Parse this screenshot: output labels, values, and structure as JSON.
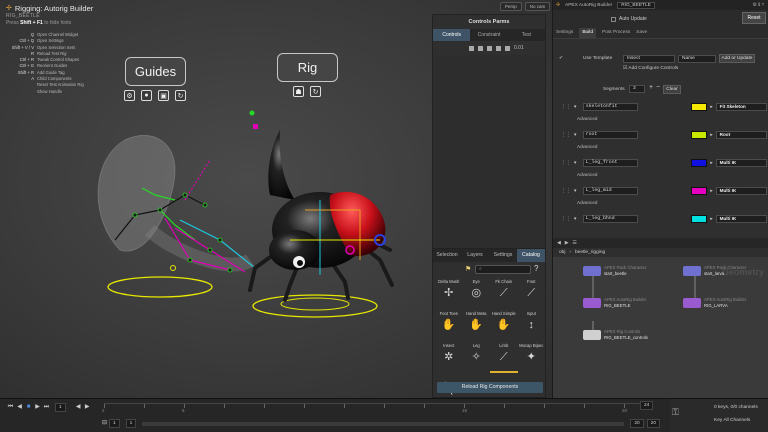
{
  "viewport": {
    "title": "Rigging: Autorig Builder",
    "node": "RIG_BEETLE",
    "hint_prefix": "Press",
    "hint_key": "Shift + F1",
    "hint_suffix": "to hide hints",
    "persp_label": "Persp",
    "cam_label": "No cam",
    "hotkeys": [
      {
        "key": "Q",
        "desc": "Open Channel Widget"
      },
      {
        "key": "Ctrl + Q",
        "desc": "Open Settings"
      },
      {
        "key": "Shift + V / V",
        "desc": "Open Selection Sets"
      },
      {
        "key": "R",
        "desc": "Reload Test Rig"
      },
      {
        "key": "Ctrl + R",
        "desc": "Tweak Control Shapes"
      },
      {
        "key": "Ctrl + G",
        "desc": "Reorient Guides"
      },
      {
        "key": "Shift + R",
        "desc": "Add Guide Tag"
      },
      {
        "key": "A",
        "desc": "Child Components"
      },
      {
        "key": "",
        "desc": "Reset Test Animation Rig"
      },
      {
        "key": "",
        "desc": "Show Handle"
      }
    ],
    "guides_label": "Guides",
    "rig_label": "Rig"
  },
  "controls_panel": {
    "title": "Controls Parms",
    "tabs": [
      "Controls",
      "Constraint",
      "Test"
    ],
    "value": "0.01"
  },
  "catalog": {
    "tabs": [
      "Selection",
      "Layers",
      "Settings",
      "Catalog"
    ],
    "items": [
      {
        "label": "Delta Mush",
        "icon": "✢"
      },
      {
        "label": "Eye",
        "icon": "◎"
      },
      {
        "label": "Fk Chain",
        "icon": "⟋"
      },
      {
        "label": "Foot",
        "icon": "⟋"
      },
      {
        "label": "Foot Toes",
        "icon": "✋"
      },
      {
        "label": "Hand Meta",
        "icon": "✋"
      },
      {
        "label": "Hand Simple",
        "icon": "✋"
      },
      {
        "label": "Input",
        "icon": "↕"
      },
      {
        "label": "Insect",
        "icon": "✲"
      },
      {
        "label": "Leg",
        "icon": "✧"
      },
      {
        "label": "Limb",
        "icon": "⟋"
      },
      {
        "label": "Mocap Bipec",
        "icon": "✦"
      },
      {
        "label": "",
        "icon": "╲"
      },
      {
        "label": "",
        "icon": "⤓"
      },
      {
        "label": "",
        "icon": "☆"
      },
      {
        "label": "",
        "icon": "⟋"
      }
    ],
    "reload_label": "Reload Rig Components"
  },
  "params": {
    "app_label": "APEX AutoRig Builder",
    "node_name": "RIG_BEETLE",
    "auto_update": "Auto Update",
    "reset_label": "Reset",
    "tabs": [
      "Settings",
      "Build",
      "Post Process",
      "Save"
    ],
    "use_template_label": "Use Template",
    "template_value": "Insect",
    "name_value": "Name",
    "add_update_label": "Add or Update",
    "configure_label": "Add Configure Controls",
    "segments_label": "Segments",
    "segments_value": "3",
    "clear_label": "Clear",
    "advanced_label": "Advanced",
    "components": [
      {
        "name": "skeletonfit",
        "color": "#f5e800",
        "type": "Fit Skeleton"
      },
      {
        "name": "root",
        "color": "#c8e800",
        "type": "Root"
      },
      {
        "name": "L_leg_front",
        "color": "#1010e0",
        "type": "Multi IK"
      },
      {
        "name": "L_leg_mid",
        "color": "#e800c0",
        "type": "Multi IK"
      },
      {
        "name": "L_leg_bhnd",
        "color": "#00e0e0",
        "type": "Multi IK"
      }
    ]
  },
  "network": {
    "path_obj": "obj",
    "path_node": "beetle_rigging",
    "watermark": "Geometry",
    "nodes": [
      {
        "type": "APEX Pack Character",
        "name": "start_beetle",
        "color": "#7070d0"
      },
      {
        "type": "APEX Pack Character",
        "name": "start_larva",
        "color": "#7070d0"
      },
      {
        "type": "APEX AutoRig Builder",
        "name": "RIG_BEETLE",
        "color": "#9a5ad0"
      },
      {
        "type": "APEX AutoRig Builder",
        "name": "RIG_LARVA",
        "color": "#9a5ad0"
      },
      {
        "type": "APEX Rig Controls",
        "name": "RIG_BEETLE_controls",
        "color": "#d0d0d0"
      }
    ]
  },
  "timeline": {
    "frame": "1",
    "start": "1",
    "end": "1",
    "range_end_a": "20",
    "range_end_b": "20",
    "fps": "24",
    "keys_label": "0 keys, 0/0 channels",
    "key_all_label": "Key All Channels",
    "ruler_ticks": [
      "2",
      "",
      "6",
      "",
      "",
      "",
      "",
      "",
      "",
      "16",
      "",
      "",
      "",
      "20"
    ]
  }
}
